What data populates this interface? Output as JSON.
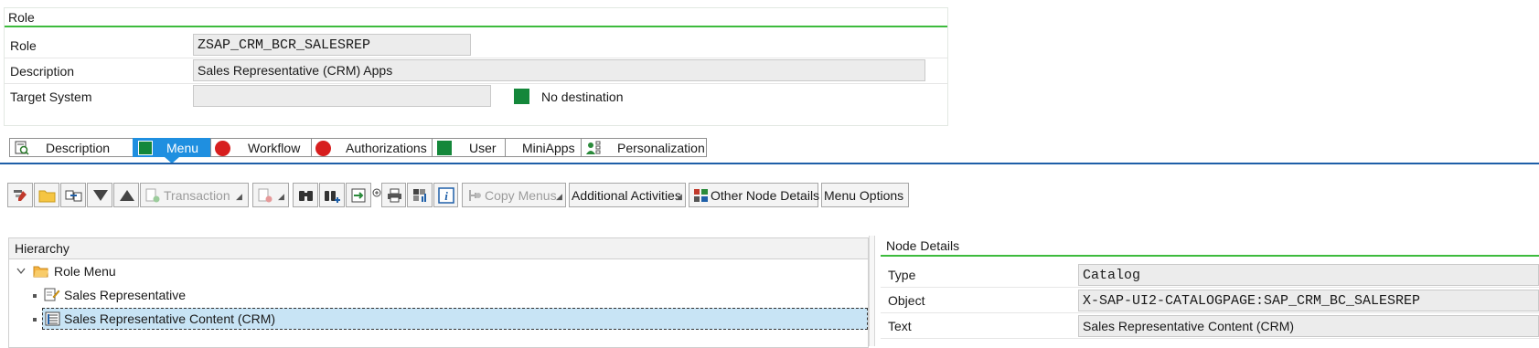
{
  "role_group": {
    "title": "Role",
    "role_label": "Role",
    "role_value": "ZSAP_CRM_BCR_SALESREP",
    "description_label": "Description",
    "description_value": "Sales Representative (CRM) Apps",
    "target_system_label": "Target System",
    "target_system_value": "",
    "target_status_text": "No destination",
    "target_status_color": "#14873a"
  },
  "tabs": [
    {
      "label": "Description",
      "icon": "document-check-icon",
      "active": false
    },
    {
      "label": "Menu",
      "icon": "status-green-icon",
      "active": true
    },
    {
      "label": "Workflow",
      "icon": "status-red-icon",
      "active": false
    },
    {
      "label": "Authorizations",
      "icon": "status-red-icon",
      "active": false
    },
    {
      "label": "User",
      "icon": "status-green-icon",
      "active": false
    },
    {
      "label": "MiniApps",
      "icon": "",
      "active": false
    },
    {
      "label": "Personalization",
      "icon": "personalization-icon",
      "active": false
    }
  ],
  "toolbar": {
    "transaction_label": "Transaction",
    "copy_menus_label": "Copy Menus",
    "additional_activities_label": "Additional Activities",
    "other_node_details_label": "Other Node Details",
    "menu_options_label": "Menu Options"
  },
  "hierarchy": {
    "title": "Hierarchy",
    "root_label": "Role Menu",
    "items": [
      {
        "label": "Sales Representative",
        "icon": "folder-edit-icon",
        "selected": false
      },
      {
        "label": "Sales Representative Content (CRM)",
        "icon": "catalog-icon",
        "selected": true
      }
    ]
  },
  "node_details": {
    "title": "Node Details",
    "type_label": "Type",
    "type_value": "Catalog",
    "object_label": "Object",
    "object_value": "X-SAP-UI2-CATALOGPAGE:SAP_CRM_BC_SALESREP",
    "text_label": "Text",
    "text_value": "Sales Representative Content (CRM)"
  },
  "colors": {
    "accent_green": "#3dbb3d",
    "status_green": "#14873a",
    "status_red": "#d71e1e",
    "active_tab": "#1f8fe0",
    "selection": "#c8e4f5"
  }
}
